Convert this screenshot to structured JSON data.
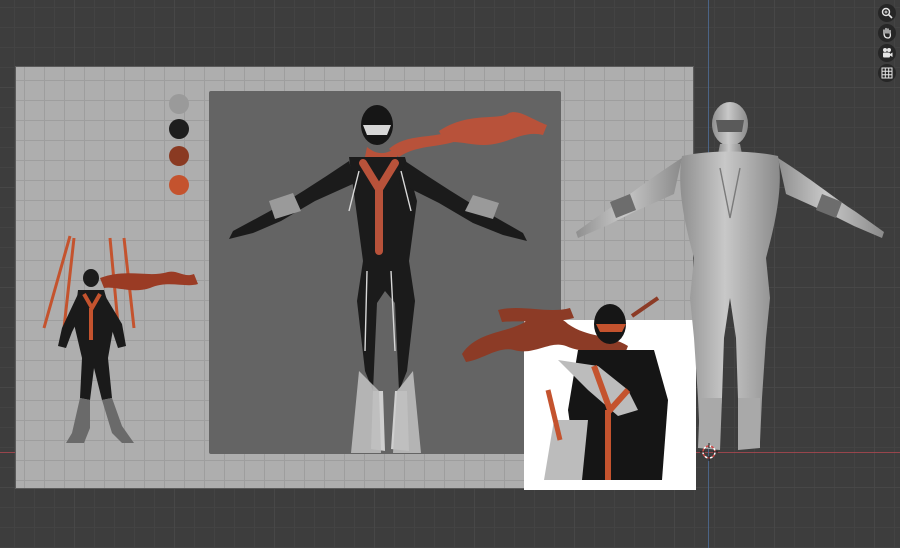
{
  "viewport": {
    "colors": {
      "background": "#3d3d3d",
      "sheet": "#aeaeae",
      "axis_x": "#a8464f",
      "axis_y": "#4e6b93"
    }
  },
  "gizmos": [
    {
      "icon": "zoom-icon"
    },
    {
      "icon": "hand-pan-icon"
    },
    {
      "icon": "camera-icon"
    },
    {
      "icon": "grid-icon"
    }
  ],
  "palette": {
    "swatches": [
      "#9a9a9a",
      "#1e1e1e",
      "#8a3a22",
      "#c4532e"
    ]
  },
  "references": [
    {
      "name": "small-turnaround-sketch"
    },
    {
      "name": "front-painted-concept"
    },
    {
      "name": "action-pose-sketch"
    },
    {
      "name": "grey-base-mesh"
    }
  ]
}
